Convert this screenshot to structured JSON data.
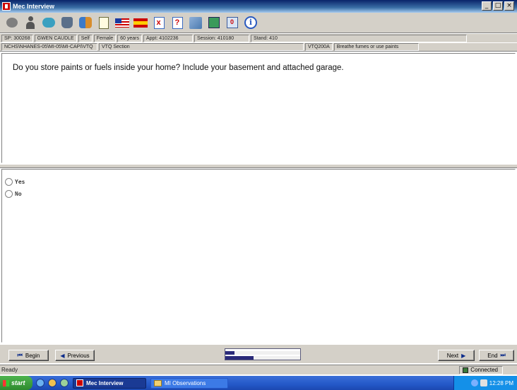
{
  "window": {
    "title": "Mec Interview",
    "controls": [
      "_",
      "□",
      "×"
    ]
  },
  "toolbar": {
    "icons": [
      "headset-icon",
      "person-icon",
      "chat-icon",
      "hand-icon",
      "two-people-icon",
      "notes-icon",
      "us-flag-icon",
      "spain-flag-icon",
      "x-sheet-icon",
      "help-sheet-icon",
      "copy-icon",
      "save-icon",
      "calculator-icon",
      "info-icon"
    ]
  },
  "info": {
    "sp": "SP: 300268",
    "name": "GWEN CAUDLE",
    "respondent": "Self",
    "gender": "Female",
    "age": "60 years",
    "appt": "Appt: 4102236",
    "session": "Session: 410180",
    "stand": "Stand: 410"
  },
  "path": {
    "location": "NCHS\\NHANES-05\\MI-05\\MI-CAPI\\VTQ",
    "section": "VTQ Section",
    "item_code": "VTQ200A",
    "item_label": "Breathe fumes or use paints"
  },
  "question": {
    "text": "Do you store paints or fuels inside your home? Include your basement and attached garage."
  },
  "answers": {
    "options": [
      {
        "label": "Yes",
        "selected": false
      },
      {
        "label": "No",
        "selected": false
      }
    ]
  },
  "navigation": {
    "begin": "Begin",
    "previous": "Previous",
    "next": "Next",
    "end": "End",
    "progress": {
      "bar1": 0.12,
      "bar2": 0.38
    }
  },
  "status": {
    "ready": "Ready",
    "connection": "Connected"
  },
  "taskbar": {
    "start": "start",
    "tasks": [
      {
        "label": "Mec Interview",
        "active": true
      },
      {
        "label": "MI Observations",
        "active": false
      }
    ],
    "clock": "12:28 PM"
  }
}
